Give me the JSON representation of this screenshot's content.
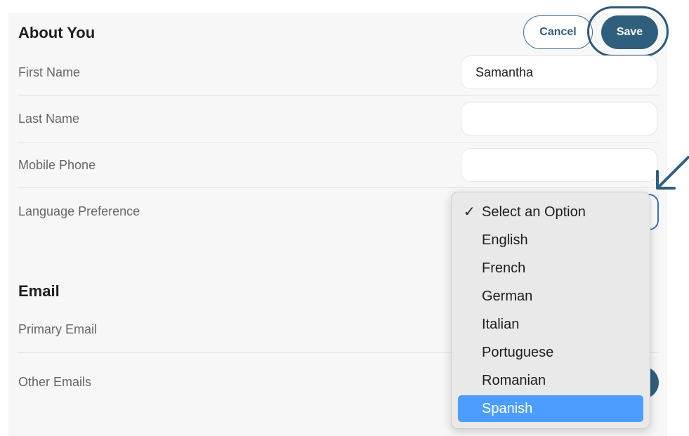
{
  "about": {
    "title": "About You",
    "cancel_label": "Cancel",
    "save_label": "Save",
    "first_name_label": "First Name",
    "first_name_value": "Samantha",
    "last_name_label": "Last Name",
    "last_name_value": "",
    "mobile_label": "Mobile Phone",
    "mobile_value": "",
    "language_label": "Language Preference"
  },
  "email": {
    "title": "Email",
    "primary_label": "Primary Email",
    "other_label": "Other Emails"
  },
  "language_dropdown": {
    "options": [
      "Select an Option",
      "English",
      "French",
      "German",
      "Italian",
      "Portuguese",
      "Romanian",
      "Spanish"
    ],
    "checked": "Select an Option",
    "highlighted": "Spanish",
    "check_glyph": "✓"
  },
  "colors": {
    "primary": "#2f5f7d",
    "highlight": "#4c9dff",
    "focus_border": "#2f6fd0"
  }
}
